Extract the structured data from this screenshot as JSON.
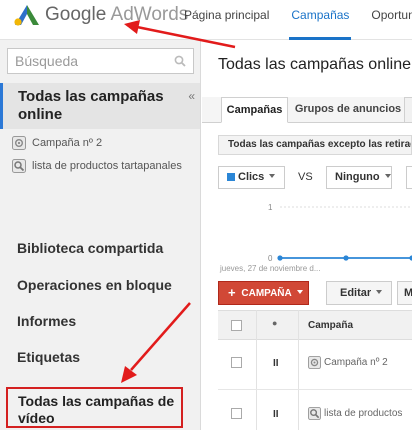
{
  "brand": {
    "google": "Google",
    "product": "AdWords"
  },
  "nav": {
    "tabs": [
      {
        "label": "Página principal",
        "active": false
      },
      {
        "label": "Campañas",
        "active": true
      },
      {
        "label": "Oportunida",
        "active": false
      }
    ]
  },
  "sidebar": {
    "search_placeholder": "Búsqueda",
    "tree_header": "Todas las campañas online",
    "collapse_glyph": "«",
    "tree_items": [
      {
        "label": "Campaña nº 2",
        "icon": "campaign-icon"
      },
      {
        "label": "lista de productos tartapanales",
        "icon": "shopping-campaign-icon"
      }
    ],
    "sections": [
      "Biblioteca compartida",
      "Operaciones en bloque",
      "Informes",
      "Etiquetas"
    ],
    "highlighted_item": "Todas las campañas de vídeo",
    "highlight_color": "#d42020"
  },
  "main": {
    "title": "Todas las campañas online",
    "tabs": [
      {
        "label": "Campañas",
        "active": true
      },
      {
        "label": "Grupos de anuncios",
        "active": false
      }
    ],
    "filter": "Todas las campañas excepto las retirada",
    "metric_primary": "Clics",
    "metric_vs": "VS",
    "metric_secondary": "Ninguno",
    "chart_label": "jueves, 27 de noviembre d...",
    "add_button": "CAMPAÑA",
    "edit_button": "Editar",
    "more_button": "M",
    "table": {
      "header_name": "Campaña",
      "status_glyph": "●",
      "rows": [
        {
          "status": "II",
          "name": "Campaña nº 2",
          "icon": "campaign-icon"
        },
        {
          "status": "II",
          "name": "lista de productos",
          "icon": "shopping-campaign-icon"
        }
      ]
    }
  },
  "chart_data": {
    "type": "line",
    "categories": [],
    "y_ticks": [
      "1",
      "0"
    ],
    "x_label": "jueves, 27 de noviembre d...",
    "ylim": [
      0,
      1
    ],
    "series": [
      {
        "values": [
          0,
          0,
          0
        ]
      }
    ],
    "color": "#2b86d6"
  },
  "accent": "#1a73c8",
  "annotation_color": "#e21b1b"
}
